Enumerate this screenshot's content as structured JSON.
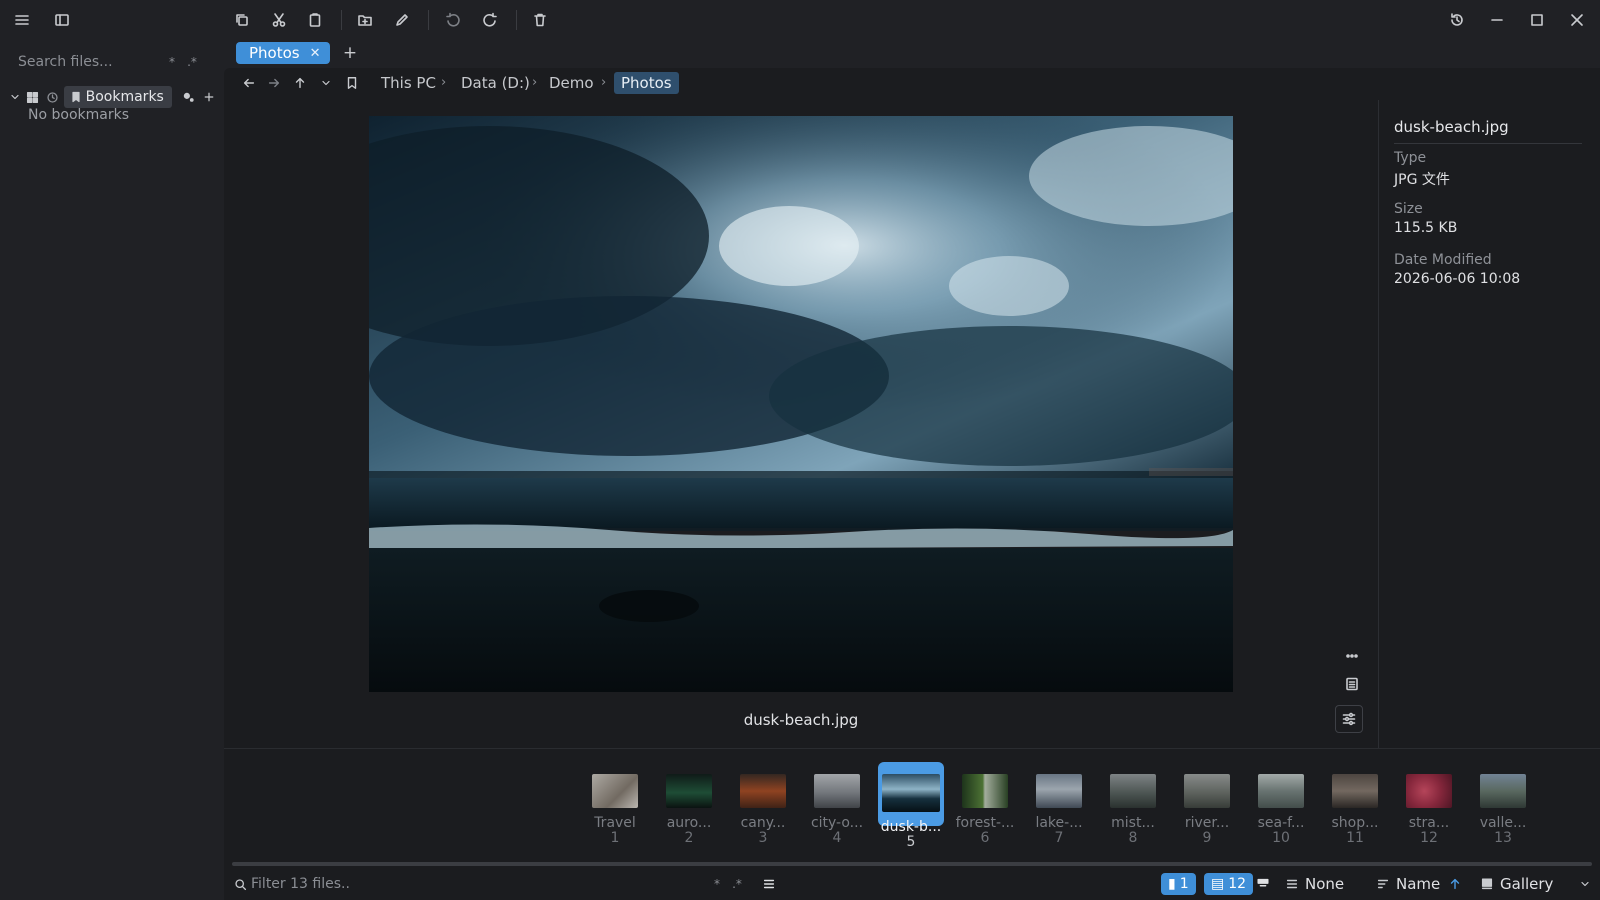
{
  "tabs": [
    {
      "label": "Photos"
    }
  ],
  "sidebar": {
    "search_placeholder": "Search files...",
    "search_opts": [
      "*",
      ".*"
    ],
    "bookmarks_label": "Bookmarks",
    "empty_text": "No bookmarks"
  },
  "breadcrumb": [
    "This PC",
    "Data (D:)",
    "Demo",
    "Photos"
  ],
  "preview": {
    "caption": "dusk-beach.jpg"
  },
  "details": {
    "filename": "dusk-beach.jpg",
    "fields": [
      {
        "label": "Type",
        "value": "JPG 文件"
      },
      {
        "label": "Size",
        "value": "115.5 KB"
      },
      {
        "label": "Date Modified",
        "value": "2026-06-06 10:08"
      }
    ]
  },
  "filmstrip": [
    {
      "name": "Travel",
      "num": "1"
    },
    {
      "name": "auro...",
      "num": "2"
    },
    {
      "name": "cany...",
      "num": "3"
    },
    {
      "name": "city-o...",
      "num": "4"
    },
    {
      "name": "dusk-b...",
      "num": "5",
      "selected": true
    },
    {
      "name": "forest-...",
      "num": "6"
    },
    {
      "name": "lake-...",
      "num": "7"
    },
    {
      "name": "mist...",
      "num": "8"
    },
    {
      "name": "river...",
      "num": "9"
    },
    {
      "name": "sea-f...",
      "num": "10"
    },
    {
      "name": "shop...",
      "num": "11"
    },
    {
      "name": "stra...",
      "num": "12"
    },
    {
      "name": "valle...",
      "num": "13"
    }
  ],
  "statusbar": {
    "filter_placeholder": "Filter 13 files..",
    "filter_opts": [
      "*",
      ".*"
    ],
    "folder_count": "1",
    "file_count": "12",
    "group_label": "None",
    "sort_label": "Name",
    "view_label": "Gallery"
  },
  "colors": {
    "accent": "#3f8fd8",
    "background": "#202125",
    "panel": "#1b1c1f"
  }
}
